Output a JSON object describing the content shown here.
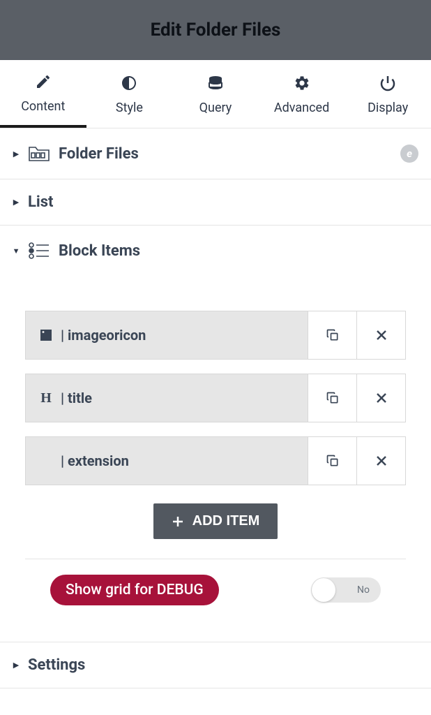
{
  "header": {
    "title": "Edit Folder Files"
  },
  "tabs": [
    {
      "label": "Content",
      "icon": "pencil",
      "active": true
    },
    {
      "label": "Style",
      "icon": "contrast",
      "active": false
    },
    {
      "label": "Query",
      "icon": "database",
      "active": false
    },
    {
      "label": "Advanced",
      "icon": "gear",
      "active": false
    },
    {
      "label": "Display",
      "icon": "power",
      "active": false
    }
  ],
  "sections": {
    "folder_files": {
      "title": "Folder Files",
      "expanded": false,
      "badge": "e"
    },
    "list": {
      "title": "List",
      "expanded": false
    },
    "block_items": {
      "title": "Block Items",
      "expanded": true,
      "items": [
        {
          "label": "| imageoricon",
          "icon": "image"
        },
        {
          "label": "| title",
          "icon": "heading"
        },
        {
          "label": "| extension",
          "icon": ""
        }
      ]
    },
    "settings": {
      "title": "Settings",
      "expanded": false
    }
  },
  "add_item": {
    "label": "ADD ITEM"
  },
  "debug": {
    "label": "Show grid for DEBUG",
    "toggle_label": "No",
    "value": false
  }
}
